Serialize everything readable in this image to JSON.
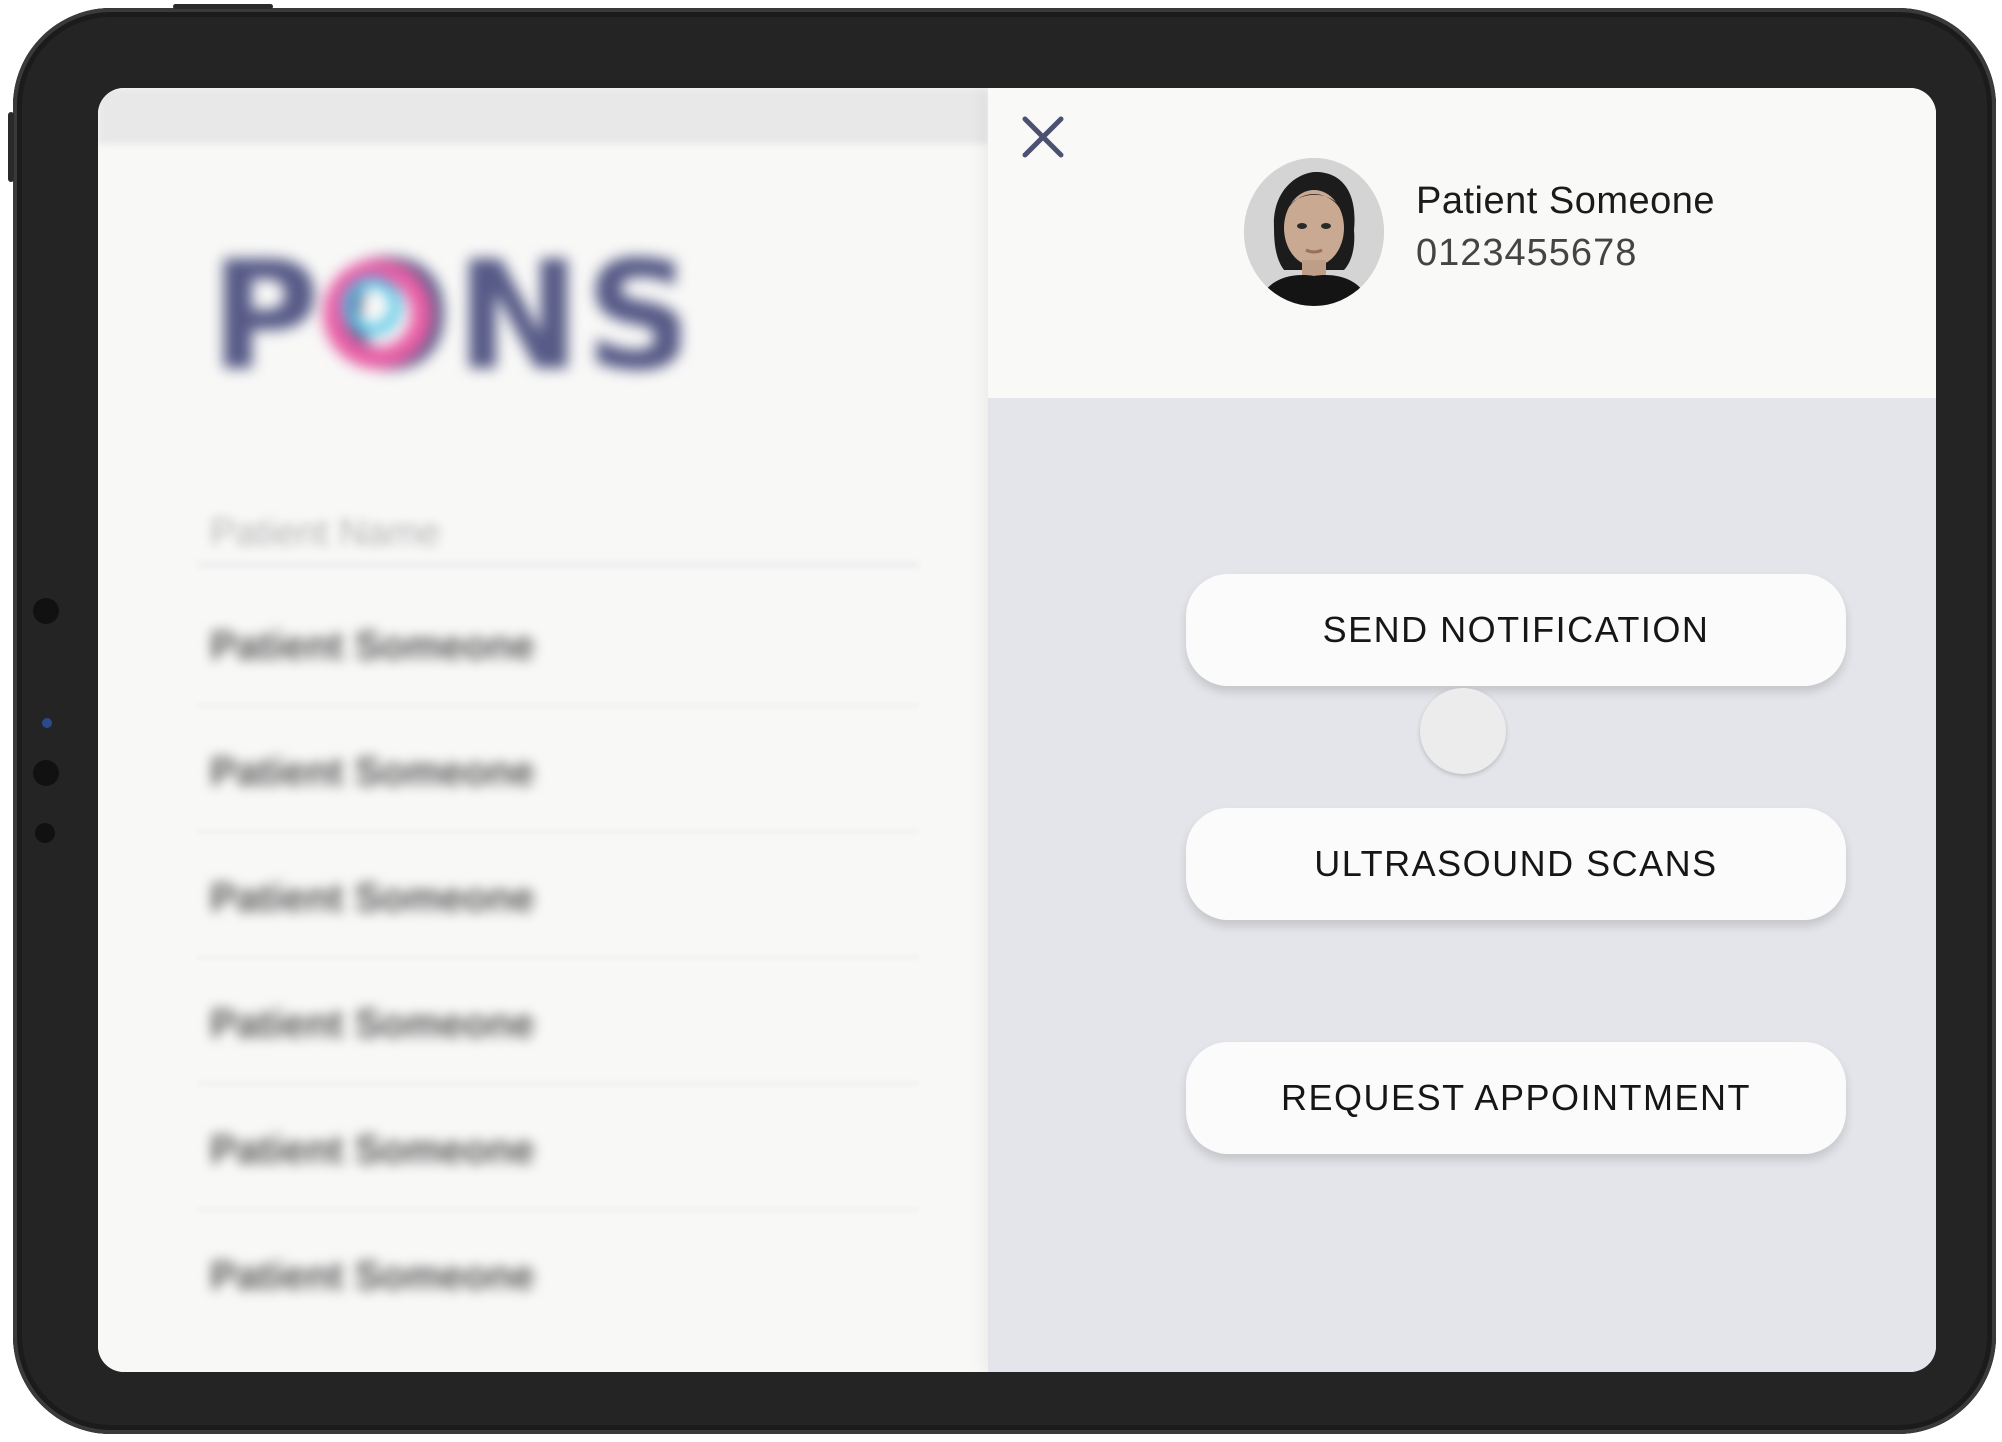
{
  "app": {
    "brand": "PONS"
  },
  "list": {
    "heading": "Patient Name",
    "items": [
      "Patient Someone",
      "Patient Someone",
      "Patient Someone",
      "Patient Someone",
      "Patient Someone",
      "Patient Someone"
    ]
  },
  "patient": {
    "name": "Patient Someone",
    "phone": "0123455678"
  },
  "actions": {
    "send_notification": "SEND NOTIFICATION",
    "ultrasound_scans": "ULTRASOUND SCANS",
    "request_appointment": "REQUEST APPOINTMENT"
  },
  "icons": {
    "close": "close-icon",
    "avatar": "patient-avatar"
  },
  "colors": {
    "brand_navy": "#565a86",
    "brand_pink": "#e75fa6",
    "brand_cyan": "#4cc4e6",
    "panel_bg": "#e4e5ea",
    "close_icon": "#4c5071"
  }
}
